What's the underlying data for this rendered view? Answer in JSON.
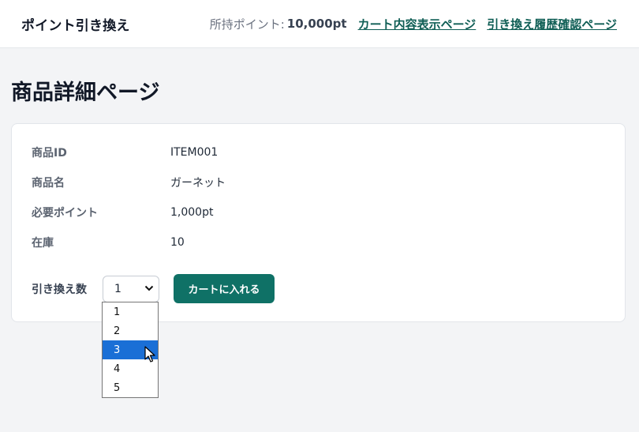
{
  "header": {
    "brand": "ポイント引き換え",
    "points_label": "所持ポイント:",
    "points_value": "10,000pt",
    "links": [
      "カート内容表示ページ",
      "引き換え履歴確認ページ"
    ]
  },
  "page_title": "商品詳細ページ",
  "details": [
    {
      "label": "商品ID",
      "value": "ITEM001"
    },
    {
      "label": "商品名",
      "value": "ガーネット"
    },
    {
      "label": "必要ポイント",
      "value": "1,000pt"
    },
    {
      "label": "在庫",
      "value": "10"
    }
  ],
  "quantity": {
    "label": "引き換え数",
    "selected": "1",
    "options": [
      "1",
      "2",
      "3",
      "4",
      "5"
    ],
    "highlighted": "3"
  },
  "add_button": "カートに入れる",
  "colors": {
    "accent": "#0f7166",
    "link": "#0f5e55",
    "highlight": "#1a6fd6"
  }
}
